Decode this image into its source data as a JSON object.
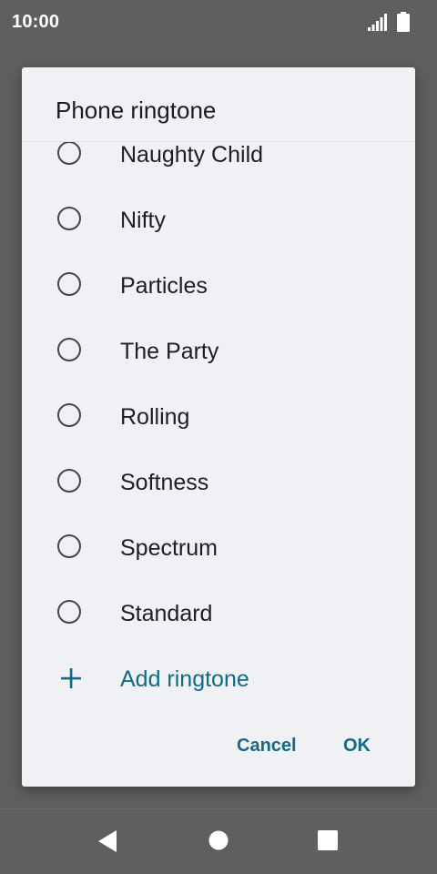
{
  "status_bar": {
    "time": "10:00",
    "signal_icon": "cellular-signal-icon",
    "battery_icon": "battery-full-icon"
  },
  "dialog": {
    "title": "Phone ringtone",
    "ringtones": [
      {
        "label": "Naughty Child",
        "selected": false
      },
      {
        "label": "Nifty",
        "selected": false
      },
      {
        "label": "Particles",
        "selected": false
      },
      {
        "label": "The Party",
        "selected": false
      },
      {
        "label": "Rolling",
        "selected": false
      },
      {
        "label": "Softness",
        "selected": false
      },
      {
        "label": "Spectrum",
        "selected": false
      },
      {
        "label": "Standard",
        "selected": false
      }
    ],
    "add_ringtone_label": "Add ringtone",
    "cancel_label": "Cancel",
    "ok_label": "OK"
  },
  "colors": {
    "accent": "#126a85",
    "dialog_bg": "#eff1f4",
    "scrim": "#5f5f5f",
    "radio_outline": "#44474d"
  },
  "nav_bar": {
    "back_icon": "back-triangle-icon",
    "home_icon": "home-circle-icon",
    "recent_icon": "recent-apps-square-icon"
  }
}
